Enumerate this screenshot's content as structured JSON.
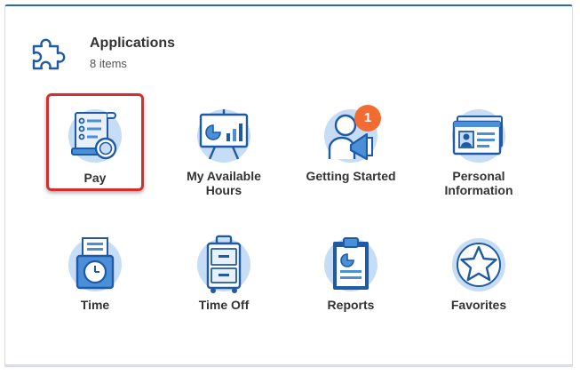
{
  "header": {
    "title": "Applications",
    "count_label": "8 items",
    "icon": "puzzle-icon"
  },
  "colors": {
    "accent": "#2c6ba8",
    "icon_dark": "#1f5aa6",
    "icon_light": "#c7ddf5",
    "selection": "#d32f2f",
    "badge": "#f26b32"
  },
  "apps": [
    {
      "label": "Pay",
      "icon": "pay-icon",
      "selected": true
    },
    {
      "label": "My Available Hours",
      "icon": "presentation-chart-icon"
    },
    {
      "label": "Getting Started",
      "icon": "person-megaphone-icon",
      "badge": "1"
    },
    {
      "label": "Personal Information",
      "icon": "id-card-icon"
    },
    {
      "label": "Time",
      "icon": "time-clock-icon"
    },
    {
      "label": "Time Off",
      "icon": "suitcase-icon"
    },
    {
      "label": "Reports",
      "icon": "clipboard-report-icon"
    },
    {
      "label": "Favorites",
      "icon": "star-icon"
    }
  ]
}
